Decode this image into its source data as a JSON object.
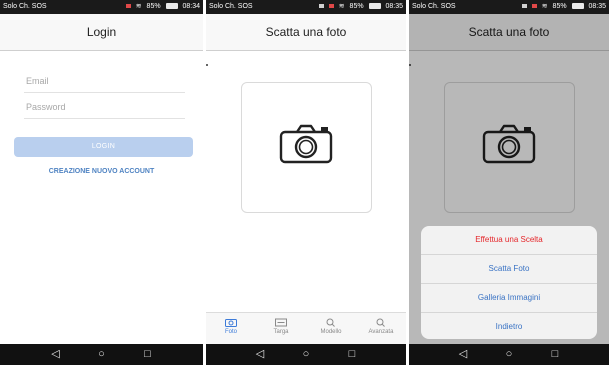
{
  "status_bar": {
    "carrier": "Solo Ch. SOS",
    "battery": "85%",
    "times": [
      "08:34",
      "08:35",
      "08:35"
    ]
  },
  "screen1": {
    "title": "Login",
    "email_placeholder": "Email",
    "password_placeholder": "Password",
    "login_label": "LOGIN",
    "create_account_label": "CREAZIONE NUOVO ACCOUNT"
  },
  "screen2": {
    "title": "Scatta una foto",
    "tabs": [
      {
        "label": "Foto",
        "icon": "camera-icon",
        "active": true
      },
      {
        "label": "Targa",
        "icon": "license-plate-icon",
        "active": false
      },
      {
        "label": "Modello",
        "icon": "search-icon",
        "active": false
      },
      {
        "label": "Avanzata",
        "icon": "search-icon",
        "active": false
      }
    ]
  },
  "screen3": {
    "title": "Scatta una foto",
    "sheet": {
      "title": "Effettua una Scelta",
      "options": [
        "Scatta Foto",
        "Galleria Immagini",
        "Indietro"
      ]
    }
  },
  "nav_bar": {
    "icons": [
      "back-icon",
      "home-icon",
      "recents-icon"
    ],
    "glyphs": [
      "◁",
      "○",
      "□"
    ]
  },
  "colors": {
    "accent": "#3d7bd9",
    "login_button": "#b9cfee",
    "link": "#4f83c2",
    "sheet_title": "#e5262a"
  }
}
